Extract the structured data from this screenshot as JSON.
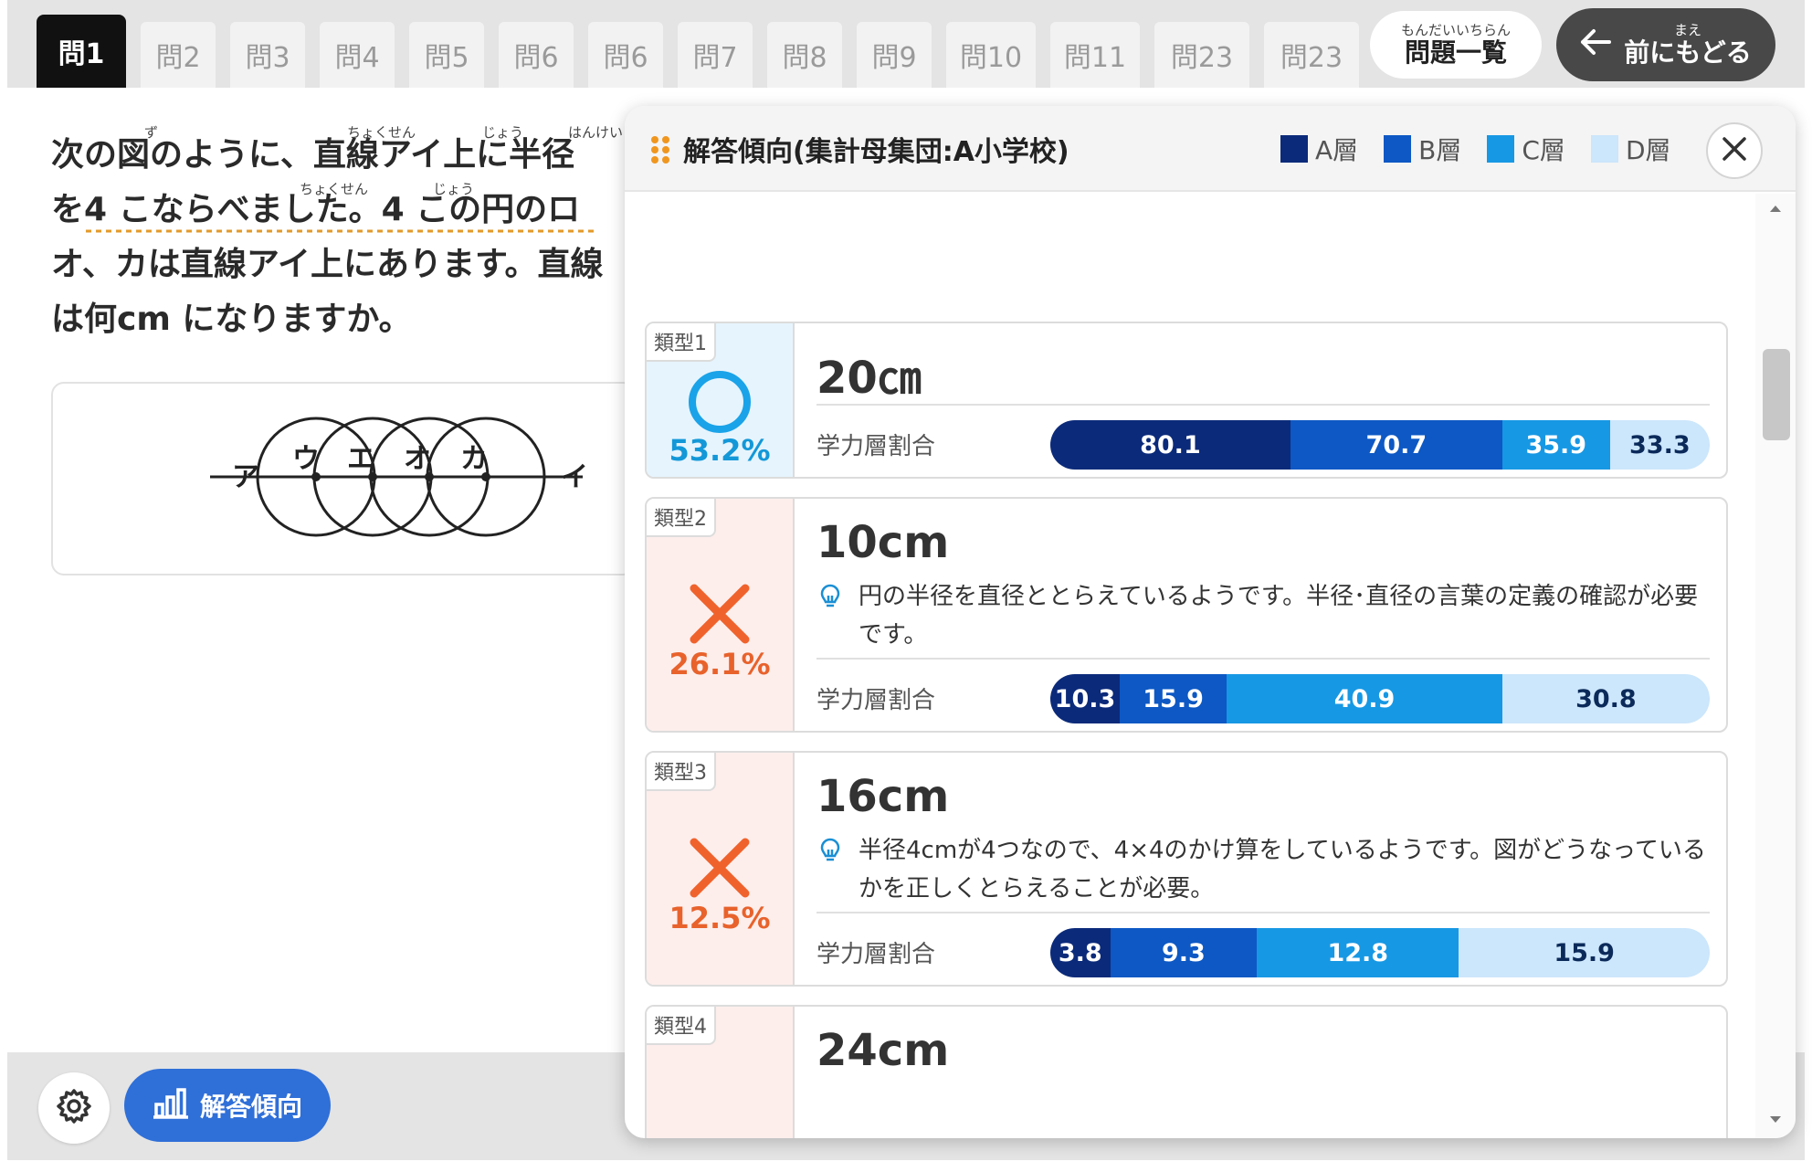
{
  "tabs": [
    "問1",
    "問2",
    "問3",
    "問4",
    "問5",
    "問6",
    "問6",
    "問7",
    "問8",
    "問9",
    "問10",
    "問11",
    "問23",
    "問23"
  ],
  "active_tab_index": 0,
  "list_button": {
    "ruby": "もんだいいちらん",
    "label": "問題一覧"
  },
  "back_button": {
    "ruby": "まえ",
    "label": "前にもどる"
  },
  "question": {
    "lines": [
      "次の図のように、直線アイ上に半径",
      "を4 こならべました。4 この円のロ",
      "オ、カは直線アイ上にあります。直線",
      "は何cm になりますか。"
    ],
    "ruby": [
      "ず",
      "ちょくせん",
      "じょう",
      "はんけい",
      "ちょくせん",
      "じょう"
    ]
  },
  "figure": {
    "labels": [
      "ア",
      "ウ",
      "エ",
      "オ",
      "カ",
      "イ"
    ]
  },
  "bottom": {
    "trend_label": "解答傾向"
  },
  "panel": {
    "title": "解答傾向(集計母集団:A小学校)",
    "legend": [
      {
        "label": "A層",
        "color": "#0b2a7a"
      },
      {
        "label": "B層",
        "color": "#0d58c4"
      },
      {
        "label": "C層",
        "color": "#1798e4"
      },
      {
        "label": "D層",
        "color": "#cce6fb"
      }
    ],
    "ratio_label": "学力層割合",
    "cards": [
      {
        "type": "類型1",
        "result": "correct",
        "percent": "53.2%",
        "answer": "20㎝",
        "hint": "",
        "segments": [
          80.1,
          70.7,
          35.9,
          33.3
        ]
      },
      {
        "type": "類型2",
        "result": "wrong",
        "percent": "26.1%",
        "answer": "10cm",
        "hint": "円の半径を直径ととらえているようです。半径･直径の言葉の定義の確認が必要です。",
        "segments": [
          10.3,
          15.9,
          40.9,
          30.8
        ]
      },
      {
        "type": "類型3",
        "result": "wrong",
        "percent": "12.5%",
        "answer": "16cm",
        "hint": "半径4cmが4つなので、4×4のかけ算をしているようです。図がどうなっているかを正しくとらえることが必要。",
        "segments": [
          3.8,
          9.3,
          12.8,
          15.9
        ]
      },
      {
        "type": "類型4",
        "result": "wrong",
        "percent": "",
        "answer": "24cm",
        "hint": "",
        "segments": []
      }
    ]
  }
}
